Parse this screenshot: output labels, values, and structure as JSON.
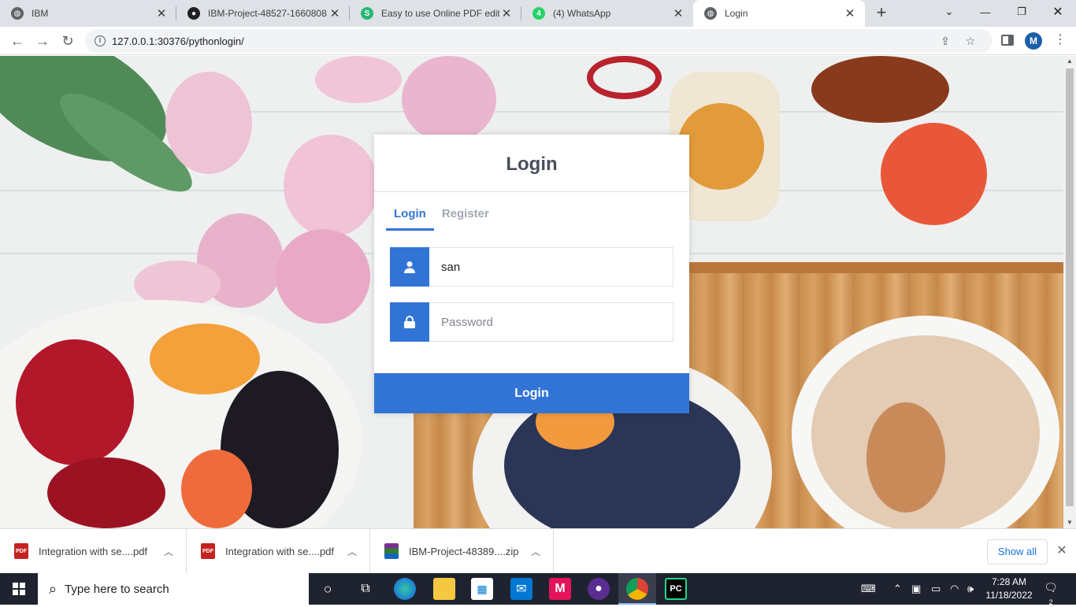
{
  "browser": {
    "tabs": [
      {
        "title": "IBM",
        "favicon": "globe-icon",
        "color": "#5f6368"
      },
      {
        "title": "IBM-Project-48527-1660808",
        "favicon": "github-icon",
        "color": "#202124"
      },
      {
        "title": "Easy to use Online PDF edito",
        "favicon": "sejda-icon",
        "color": "#27b973"
      },
      {
        "title": "(4) WhatsApp",
        "favicon": "whatsapp-icon",
        "color": "#25d366"
      },
      {
        "title": "Login",
        "favicon": "globe-icon",
        "color": "#5f6368",
        "active": true
      }
    ],
    "url": "127.0.0.1:30376/pythonlogin/",
    "profile_initial": "M"
  },
  "login": {
    "title": "Login",
    "tabs": [
      "Login",
      "Register"
    ],
    "username_value": "san",
    "password_placeholder": "Password",
    "submit_label": "Login",
    "accent_color": "#3274d6"
  },
  "downloads": {
    "items": [
      {
        "name": "Integration with se....pdf",
        "type": "pdf"
      },
      {
        "name": "Integration with se....pdf",
        "type": "pdf"
      },
      {
        "name": "IBM-Project-48389....zip",
        "type": "zip"
      }
    ],
    "show_all_label": "Show all"
  },
  "taskbar": {
    "search_placeholder": "Type here to search",
    "time": "7:28 AM",
    "date": "11/18/2022",
    "notification_count": "2"
  }
}
